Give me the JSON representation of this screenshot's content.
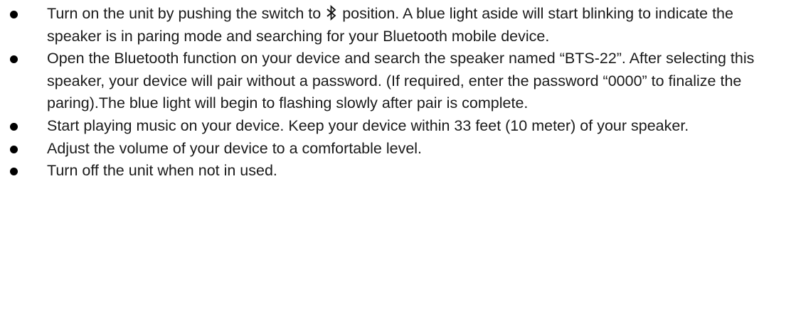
{
  "list": {
    "item1": {
      "before_icon": "Turn on the unit by pushing the switch to ",
      "icon": "bluetooth-icon",
      "after_icon": " position. A blue light aside will start blinking to indicate the speaker is in paring mode and searching for your Bluetooth mobile device."
    },
    "item2": {
      "text": "Open the Bluetooth function on your device and search the speaker named “BTS-22”. After selecting this speaker, your device will pair without a password. (If required, enter the password “0000” to finalize the paring).The blue light will begin to flashing slowly after pair is complete."
    },
    "item3": {
      "text": "Start playing music on your device. Keep your device within 33 feet (10 meter) of your speaker."
    },
    "item4": {
      "text": "Adjust the volume of your device to a comfortable level."
    },
    "item5": {
      "text": "Turn off the unit when not in used."
    }
  }
}
